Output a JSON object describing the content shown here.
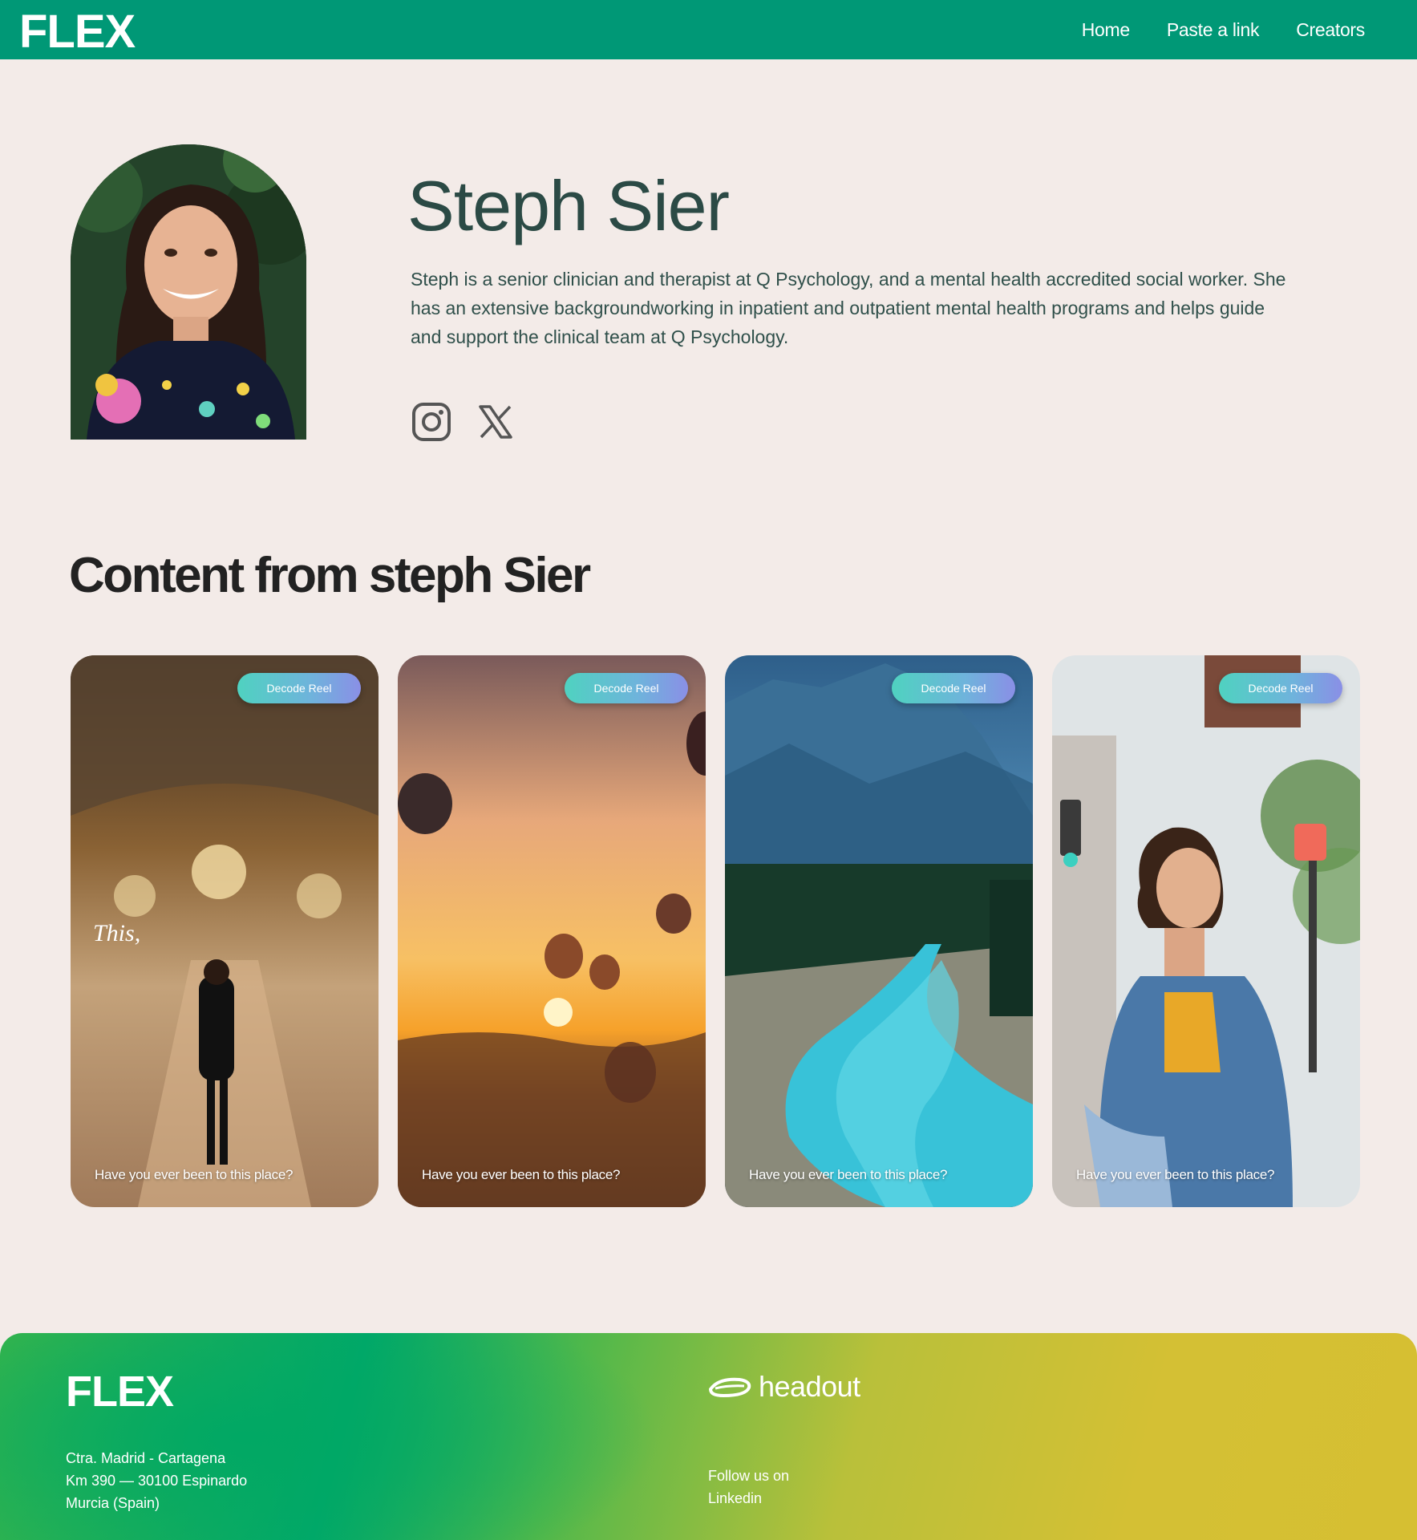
{
  "header": {
    "logo": "FLEX",
    "nav": [
      "Home",
      "Paste a link",
      "Creators"
    ]
  },
  "profile": {
    "name": "Steph Sier",
    "bio": "Steph is a senior clinician and therapist at Q Psychology, and a mental health accredited social worker. She has an extensive backgroundworking in inpatient and outpatient mental health programs and helps guide and support the clinical team at Q Psychology.",
    "socials": [
      "instagram-icon",
      "x-icon"
    ]
  },
  "content": {
    "title": "Content from steph Sier",
    "cards": [
      {
        "badge": "Decode Reel",
        "caption": "Have you ever been to this place?",
        "overlay": "This,"
      },
      {
        "badge": "Decode Reel",
        "caption": "Have you ever been to this place?"
      },
      {
        "badge": "Decode Reel",
        "caption": "Have you ever been to this place?"
      },
      {
        "badge": "Decode Reel",
        "caption": "Have you ever been to this place?"
      }
    ]
  },
  "footer": {
    "logo": "FLEX",
    "address": [
      "Ctra. Madrid - Cartagena",
      "Km 390 — 30100 Espinardo",
      "Murcia (Spain)"
    ],
    "partner": "headout",
    "follow": "Follow us on",
    "link": "Linkedin"
  },
  "colors": {
    "header_bg": "#009876",
    "page_bg": "#f3ebe8",
    "name_color": "#2b4a45"
  }
}
